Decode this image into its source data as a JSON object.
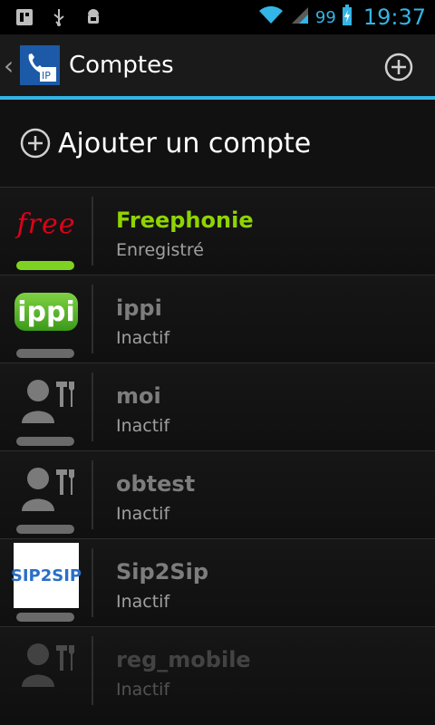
{
  "status_bar": {
    "battery": "99",
    "time": "19:37"
  },
  "action_bar": {
    "title": "Comptes"
  },
  "add_account": {
    "label": "Ajouter un compte"
  },
  "accounts": [
    {
      "name": "Freephonie",
      "status": "Enregistré",
      "logo": "free-logo"
    },
    {
      "name": "ippi",
      "status": "Inactif",
      "logo": "ippi-logo"
    },
    {
      "name": "moi",
      "status": "Inactif",
      "logo": "user-tools-icon"
    },
    {
      "name": "obtest",
      "status": "Inactif",
      "logo": "user-tools-icon"
    },
    {
      "name": "Sip2Sip",
      "status": "Inactif",
      "logo": "sip2sip-logo",
      "logo_text": "SIP2SIP"
    },
    {
      "name": "reg_mobile",
      "status": "Inactif",
      "logo": "user-tools-icon"
    }
  ],
  "logo_text": {
    "free": "free",
    "ippi": "ippi"
  },
  "colors": {
    "accent": "#33b5e5",
    "registered": "#8fd400",
    "free_red": "#e1001a"
  }
}
